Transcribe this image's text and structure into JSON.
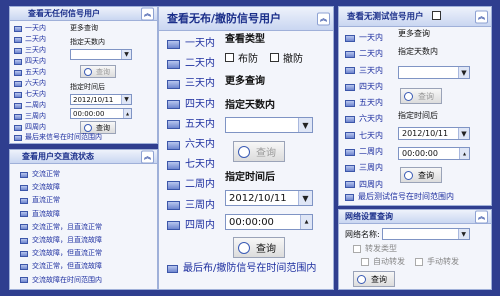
{
  "p1": {
    "title": "查看无任何信号用户",
    "more": "更多查询",
    "days_label": "指定天数内",
    "query": "查询",
    "time_label": "指定时间后",
    "date": "2012/10/11",
    "time": "00:00:00",
    "items": [
      "一天内",
      "二天内",
      "三天内",
      "四天内",
      "五天内",
      "六天内",
      "七天内",
      "二周内",
      "三周内",
      "四周内"
    ],
    "last": "最后来信号在时间范围内"
  },
  "p2": {
    "title": "查看用户交直流状态",
    "items": [
      "交流正常",
      "交流故障",
      "直流正常",
      "直流故障",
      "交流正常，且直流正常",
      "交流故障，且直流故障",
      "交流故障，但直流正常",
      "交流正常，但直流故障",
      "交流故障在时间范围内"
    ]
  },
  "p3": {
    "title": "查看无布/撤防信号用户",
    "type_label": "查看类型",
    "arm": "布防",
    "disarm": "撤防",
    "more": "更多查询",
    "days_label": "指定天数内",
    "query": "查询",
    "time_label": "指定时间后",
    "date": "2012/10/11",
    "time": "00:00:00",
    "items": [
      "一天内",
      "二天内",
      "三天内",
      "四天内",
      "五天内",
      "六天内",
      "七天内",
      "二周内",
      "三周内",
      "四周内"
    ],
    "last": "最后布/撤防信号在时间范围内"
  },
  "p4": {
    "title": "查看无测试信号用户",
    "more": "更多查询",
    "days_label": "指定天数内",
    "query": "查询",
    "time_label": "指定时间后",
    "date": "2012/10/11",
    "time": "00:00:00",
    "items": [
      "一天内",
      "二天内",
      "三天内",
      "四天内",
      "五天内",
      "六天内",
      "七天内",
      "二周内",
      "三周内",
      "四周内"
    ],
    "last": "最后测试信号在时间范围内"
  },
  "p5": {
    "title": "网络设置查询",
    "net_label": "网络名称:",
    "forward_type": "转发类型",
    "auto": "自动转发",
    "manual": "手动转发",
    "query": "查询"
  }
}
